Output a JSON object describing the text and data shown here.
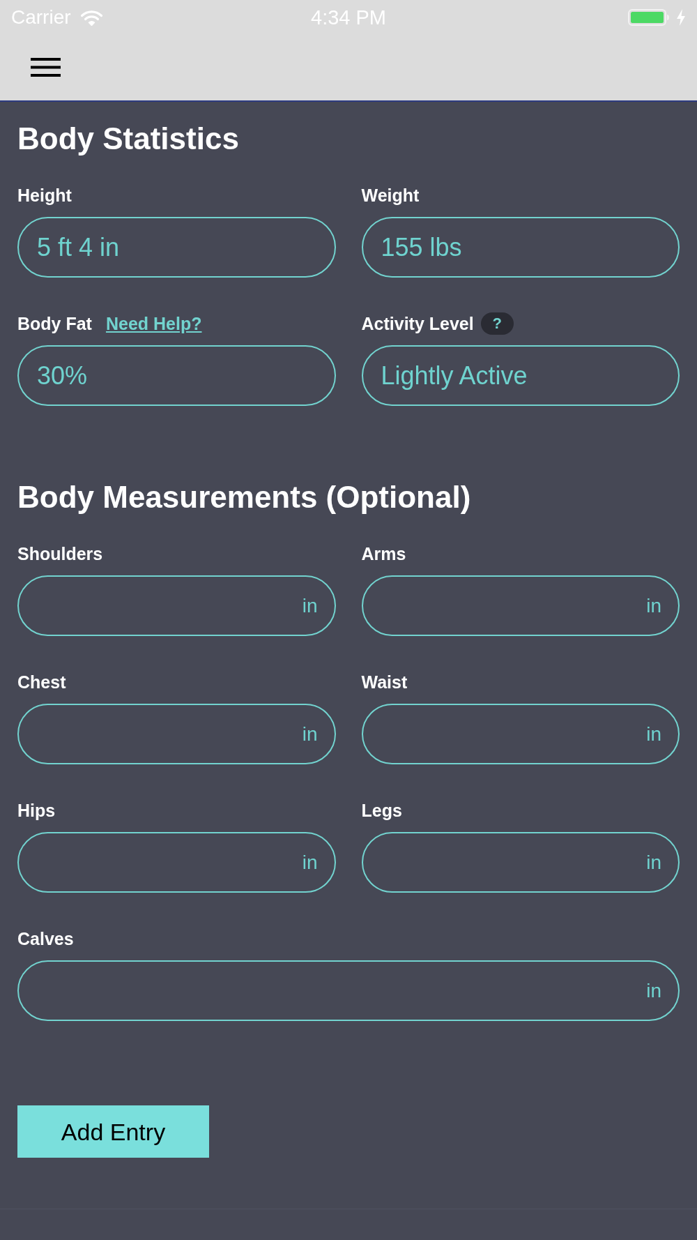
{
  "status_bar": {
    "carrier": "Carrier",
    "time": "4:34 PM"
  },
  "sections": [
    {
      "title": "Body Statistics",
      "fields": [
        {
          "label": "Height",
          "value": "5 ft 4 in"
        },
        {
          "label": "Weight",
          "value": "155 lbs"
        },
        {
          "label": "Body Fat",
          "link": "Need Help?",
          "value": "30%"
        },
        {
          "label": "Activity Level",
          "help": "?",
          "value": "Lightly Active"
        }
      ]
    },
    {
      "title": "Body Measurements (Optional)",
      "fields": [
        {
          "label": "Shoulders",
          "unit": "in"
        },
        {
          "label": "Arms",
          "unit": "in"
        },
        {
          "label": "Chest",
          "unit": "in"
        },
        {
          "label": "Waist",
          "unit": "in"
        },
        {
          "label": "Hips",
          "unit": "in"
        },
        {
          "label": "Legs",
          "unit": "in"
        },
        {
          "label": "Calves",
          "unit": "in"
        }
      ]
    }
  ],
  "button": {
    "label": "Add Entry"
  }
}
